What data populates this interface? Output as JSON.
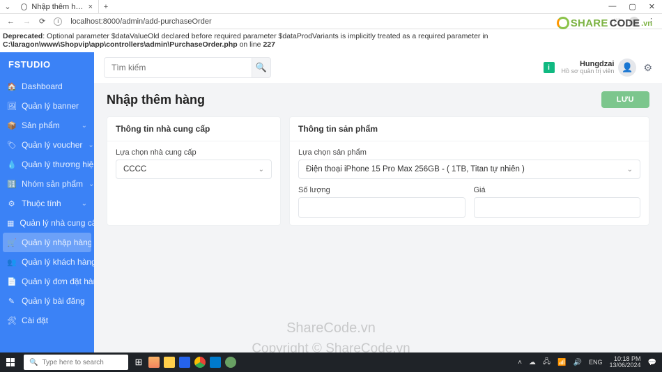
{
  "browser": {
    "tab_title": "Nhập thêm hàng",
    "url": "localhost:8000/admin/add-purchaseOrder",
    "new_tab_glyph": "+"
  },
  "error": {
    "prefix": "Deprecated",
    "msg1": ": Optional parameter $dataValueOld declared before required parameter $dataProdVariants is implicitly treated as a required parameter in ",
    "path": "C:\\laragon\\www\\Shopvip\\app\\controllers\\admin\\PurchaseOrder.php",
    "msg2": " on line ",
    "line": "227"
  },
  "brand": "FSTUDIO",
  "sidebar": {
    "items": [
      {
        "icon": "🏠",
        "label": "Dashboard",
        "exp": false
      },
      {
        "icon": "🖼",
        "label": "Quản lý banner",
        "exp": false
      },
      {
        "icon": "📦",
        "label": "Sản phẩm",
        "exp": true
      },
      {
        "icon": "🏷",
        "label": "Quản lý voucher",
        "exp": true
      },
      {
        "icon": "💧",
        "label": "Quản lý thương hiệu",
        "exp": true
      },
      {
        "icon": "🔢",
        "label": "Nhóm sản phẩm",
        "exp": true
      },
      {
        "icon": "⚙",
        "label": "Thuộc tính",
        "exp": true
      },
      {
        "icon": "▦",
        "label": "Quản lý nhà cung cấp",
        "exp": false
      },
      {
        "icon": "🛒",
        "label": "Quản lý nhập hàng",
        "exp": false,
        "active": true
      },
      {
        "icon": "👥",
        "label": "Quản lý khách hàng",
        "exp": false
      },
      {
        "icon": "📄",
        "label": "Quản lý đơn đặt hàng",
        "exp": false
      },
      {
        "icon": "✎",
        "label": "Quản lý bài đăng",
        "exp": false
      },
      {
        "icon": "🛠",
        "label": "Cài đặt",
        "exp": false
      }
    ]
  },
  "topbar": {
    "search_placeholder": "Tìm kiếm",
    "badge": "i",
    "user_name": "Hungdzai",
    "user_role": "Hồ sơ quản trị viên"
  },
  "page": {
    "title": "Nhập thêm hàng",
    "save_btn": "LƯU"
  },
  "supplier_card": {
    "title": "Thông tin nhà cung cấp",
    "select_label": "Lựa chọn nhà cung cấp",
    "select_value": "CCCC"
  },
  "product_card": {
    "title": "Thông tin sản phẩm",
    "select_label": "Lựa chọn sản phẩm",
    "select_value": "Điện thoại iPhone 15 Pro Max 256GB - ( 1TB, Titan tự nhiên )",
    "qty_label": "Số lượng",
    "price_label": "Giá"
  },
  "watermark": {
    "brand1": "SHARE",
    "brand2": "CODE",
    "brand3": ".vn",
    "center": "ShareCode.vn",
    "copy": "Copyright © ShareCode.vn"
  },
  "taskbar": {
    "search_placeholder": "Type here to search",
    "time": "10:18 PM",
    "date": "13/06/2024"
  }
}
